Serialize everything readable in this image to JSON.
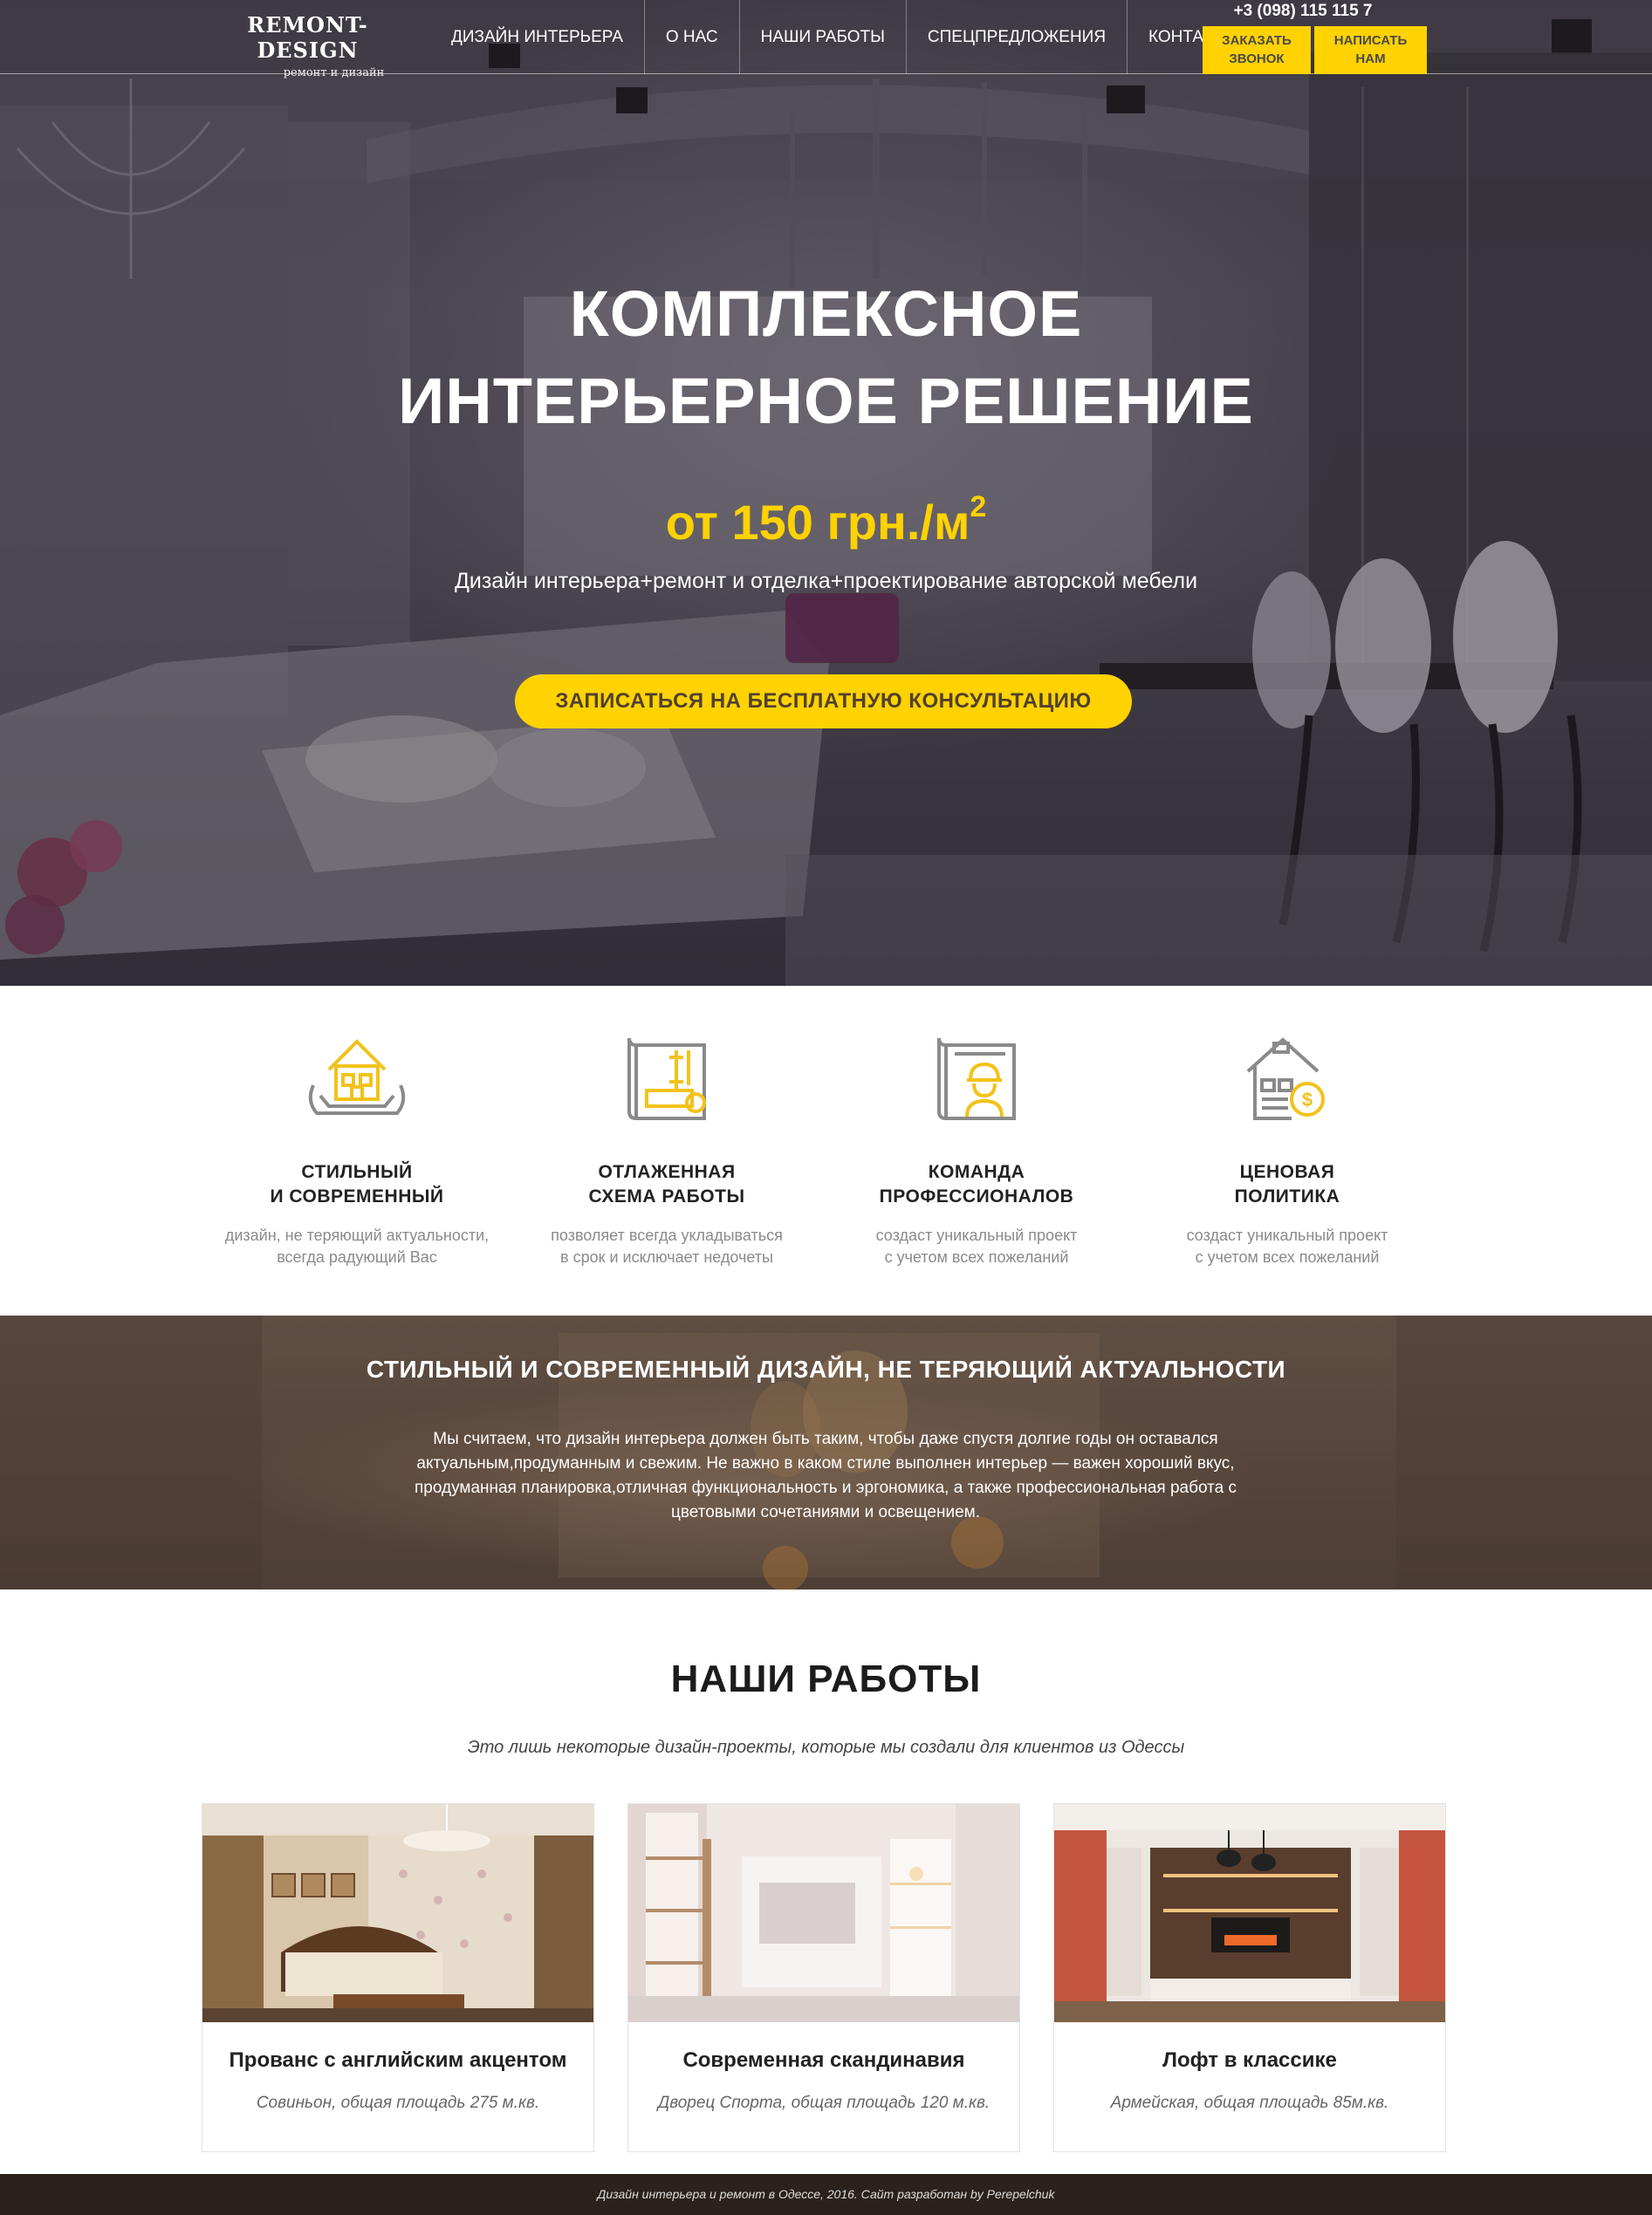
{
  "header": {
    "logo_title": "REMONT-DESIGN",
    "logo_sub": "ремонт и дизайн",
    "nav": [
      "ДИЗАЙН ИНТЕРЬЕРА",
      "О НАС",
      "НАШИ РАБОТЫ",
      "СПЕЦПРЕДЛОЖЕНИЯ",
      "КОНТАКТЫ"
    ],
    "phone": "+3 (098) 115 115 7",
    "callback_label_1": "ЗАКАЗАТЬ",
    "callback_label_2": "ЗВОНОК",
    "write_label_1": "НАПИСАТЬ",
    "write_label_2": "НАМ"
  },
  "hero": {
    "title_line1": "КОМПЛЕКСНОЕ",
    "title_line2": "ИНТЕРЬЕРНОЕ РЕШЕНИЕ",
    "price": "от 150 грн./м",
    "price_sup": "2",
    "subtitle": "Дизайн интерьера+ремонт и отделка+проектирование авторской мебели",
    "cta_label": "ЗАПИСАТЬСЯ НА БЕСПЛАТНУЮ КОНСУЛЬТАЦИЮ"
  },
  "features": [
    {
      "icon": "house-hands-icon",
      "title1": "СТИЛЬНЫЙ",
      "title2": "И СОВРЕМЕННЫЙ",
      "desc1": "дизайн, не теряющий актуальности,",
      "desc2": "всегда радующий Вас"
    },
    {
      "icon": "blueprint-icon",
      "title1": "ОТЛАЖЕННАЯ",
      "title2": "СХЕМА РАБОТЫ",
      "desc1": "позволяет всегда укладываться",
      "desc2": "в срок и исключает недочеты"
    },
    {
      "icon": "engineer-icon",
      "title1": "КОМАНДА",
      "title2": "ПРОФЕССИОНАЛОВ",
      "desc1": "создаст уникальный проект",
      "desc2": "с учетом всех пожеланий"
    },
    {
      "icon": "price-house-icon",
      "title1": "ЦЕНОВАЯ",
      "title2": "ПОЛИТИКА",
      "desc1": "создаст уникальный проект",
      "desc2": "с учетом всех пожеланий"
    }
  ],
  "about": {
    "title": "СТИЛЬНЫЙ И СОВРЕМЕННЫЙ ДИЗАЙН, НЕ ТЕРЯЮЩИЙ АКТУАЛЬНОСТИ",
    "line1": "Мы считаем, что дизайн интерьера должен быть таким, чтобы даже спустя долгие годы он оставался",
    "line2": "актуальным,продуманным и свежим. Не важно в каком стиле выполнен интерьер — важен хороший вкус,",
    "line3": "продуманная планировка,отличная функциональность и эргономика, а также профессиональная работа с",
    "line4": "цветовыми сочетаниями и освещением."
  },
  "works": {
    "title": "НАШИ РАБОТЫ",
    "subtitle": "Это лишь некоторые дизайн-проекты, которые мы создали для клиентов из Одессы",
    "items": [
      {
        "title": "Прованс с английским акцентом",
        "sub": "Совиньон, общая площадь 275 м.кв."
      },
      {
        "title": "Современная скандинавия",
        "sub": "Дворец Спорта, общая площадь 120 м.кв."
      },
      {
        "title": "Лофт в классике",
        "sub": "Армейская, общая площадь 85м.кв."
      }
    ]
  },
  "footer": {
    "text": "Дизайн интерьера и ремонт в Одессе, 2016. Сайт разработан by Perepelchuk"
  },
  "colors": {
    "accent": "#ffd200",
    "dark": "#2b221c"
  }
}
